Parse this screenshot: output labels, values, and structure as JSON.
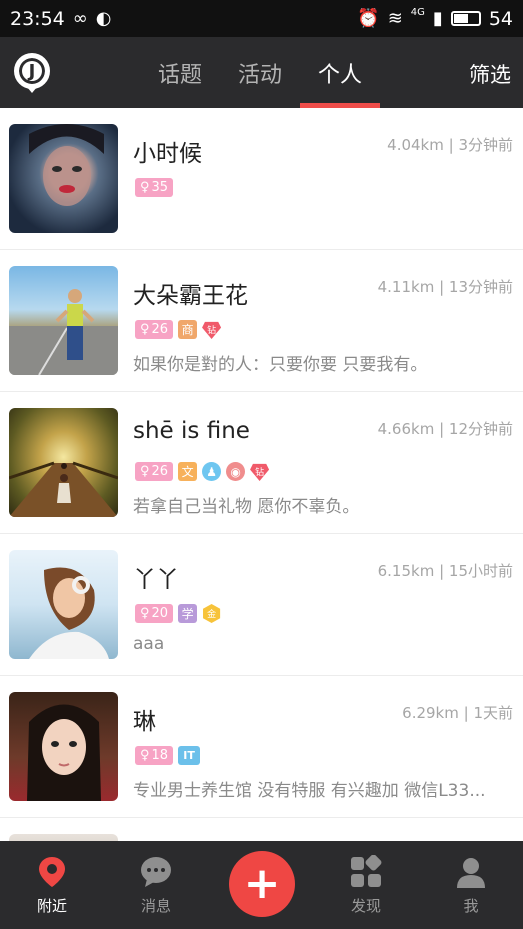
{
  "status": {
    "time": "23:54",
    "battery": "54",
    "signal_label": "4G"
  },
  "colors": {
    "accent": "#ef4d4a",
    "bar_bg": "#2b2b2d",
    "age_badge": "#f7a3c4"
  },
  "header": {
    "logo_letter": "J",
    "tabs": [
      "话题",
      "活动",
      "个人"
    ],
    "active_tab": "个人",
    "filter_label": "筛选"
  },
  "feed": [
    {
      "name": "小时候",
      "distance": "4.04km",
      "time_ago": "3分钟前",
      "age": "35",
      "tags": [],
      "signature": ""
    },
    {
      "name": "大朵霸王花",
      "distance": "4.11km",
      "time_ago": "13分钟前",
      "age": "26",
      "tags": [
        "商",
        "钻"
      ],
      "signature": "如果你是對的人：只要你要 只要我有。"
    },
    {
      "name": "shē is fine",
      "distance": "4.66km",
      "time_ago": "12分钟前",
      "age": "26",
      "tags": [
        "文",
        "qq-icon",
        "weibo-icon",
        "钻"
      ],
      "signature": "若拿自己当礼物 愿你不辜负。"
    },
    {
      "name": "丫丫",
      "distance": "6.15km",
      "time_ago": "15小时前",
      "age": "20",
      "tags": [
        "学",
        "金"
      ],
      "signature": "aaa"
    },
    {
      "name": "琳",
      "distance": "6.29km",
      "time_ago": "1天前",
      "age": "18",
      "tags": [
        "IT"
      ],
      "signature": "专业男士养生馆 没有特服 有兴趣加 微信L33..."
    }
  ],
  "bottom_nav": {
    "items": [
      "附近",
      "消息",
      "发现",
      "我"
    ],
    "active": "附近",
    "fab_label": "+"
  }
}
